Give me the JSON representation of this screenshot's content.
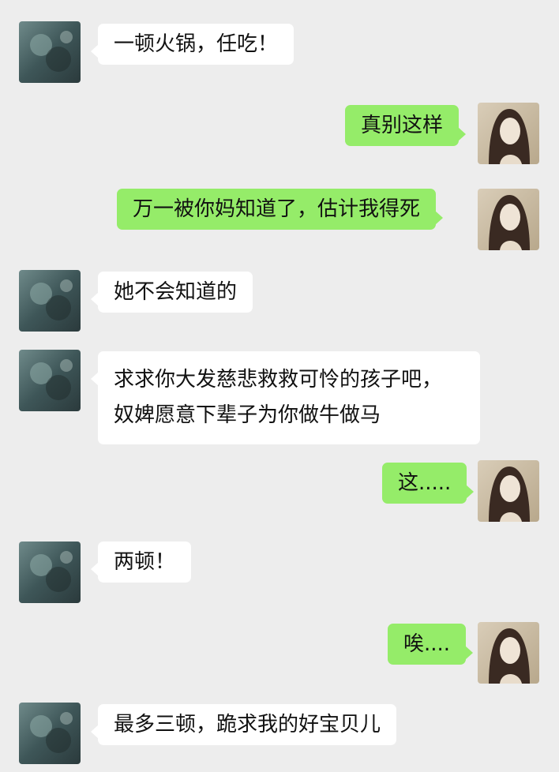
{
  "chat": {
    "messages": [
      {
        "side": "left",
        "avatar": "landscape-avatar",
        "text": "一顿火锅，任吃！"
      },
      {
        "side": "right",
        "avatar": "woman-portrait-avatar",
        "text": "真别这样"
      },
      {
        "side": "right",
        "avatar": "woman-portrait-avatar",
        "text": "万一被你妈知道了，估计我得死"
      },
      {
        "side": "left",
        "avatar": "landscape-avatar",
        "text": "她不会知道的"
      },
      {
        "side": "left",
        "avatar": "landscape-avatar",
        "lines": [
          "求求你大发慈悲救救可怜的孩子吧，",
          "奴婢愿意下辈子为你做牛做马"
        ]
      },
      {
        "side": "right",
        "avatar": "woman-portrait-avatar",
        "text": "这....."
      },
      {
        "side": "left",
        "avatar": "landscape-avatar",
        "text": "两顿！"
      },
      {
        "side": "right",
        "avatar": "woman-portrait-avatar",
        "text": "唉...."
      },
      {
        "side": "left",
        "avatar": "landscape-avatar",
        "text": "最多三顿，跪求我的好宝贝儿"
      }
    ]
  },
  "colors": {
    "background": "#ededed",
    "incoming_bubble": "#ffffff",
    "outgoing_bubble": "#95ec69"
  }
}
